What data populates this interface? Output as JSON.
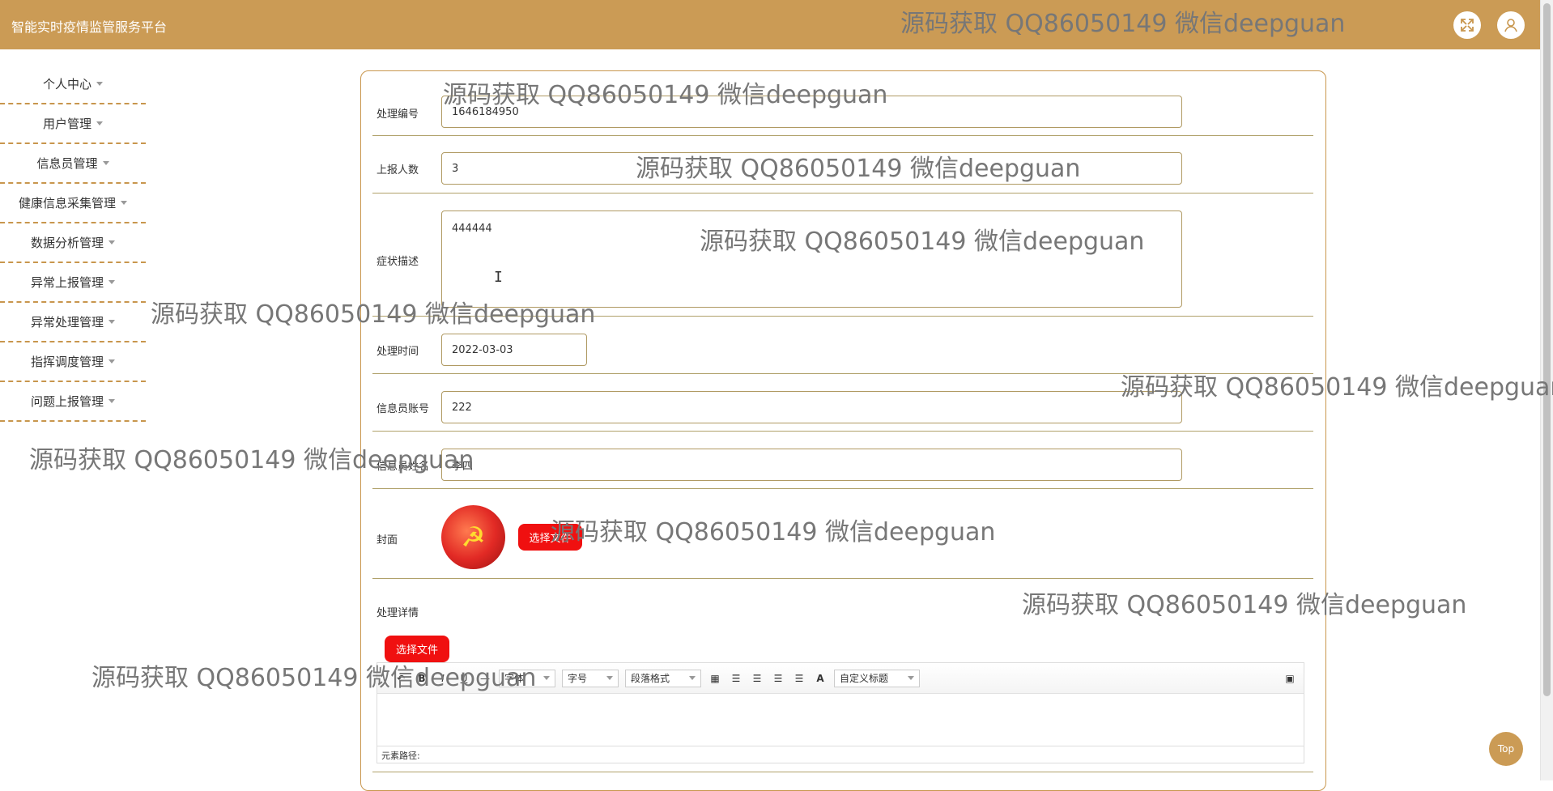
{
  "app": {
    "title": "智能实时疫情监管服务平台"
  },
  "header": {
    "icons": [
      "fullscreen-icon",
      "user-icon"
    ]
  },
  "sidebar": {
    "items": [
      "个人中心",
      "用户管理",
      "信息员管理",
      "健康信息采集管理",
      "数据分析管理",
      "异常上报管理",
      "异常处理管理",
      "指挥调度管理",
      "问题上报管理"
    ]
  },
  "form": {
    "processing_no_label": "处理编号",
    "processing_no_value": "1646184950",
    "reported_count_label": "上报人数",
    "reported_count_value": "3",
    "symptom_label": "症状描述",
    "symptom_value": "444444",
    "processing_time_label": "处理时间",
    "processing_time_value": "2022-03-03",
    "informant_account_label": "信息员账号",
    "informant_account_value": "222",
    "informant_name_label": "信息员姓名",
    "informant_name_value": "李四",
    "cover_label": "封面",
    "cover_button": "选择文件",
    "details_label": "处理详情",
    "details_button": "选择文件"
  },
  "editor": {
    "font_family": "字体",
    "font_size": "字号",
    "paragraph": "段落格式",
    "custom_title": "自定义标题",
    "status": "元素路径:"
  },
  "watermarks": [
    "源码获取 QQ86050149 微信deepguan"
  ],
  "top_button": "Top",
  "colors": {
    "accent": "#cb9b55",
    "button": "#f01010",
    "line": "#b0a16a"
  }
}
